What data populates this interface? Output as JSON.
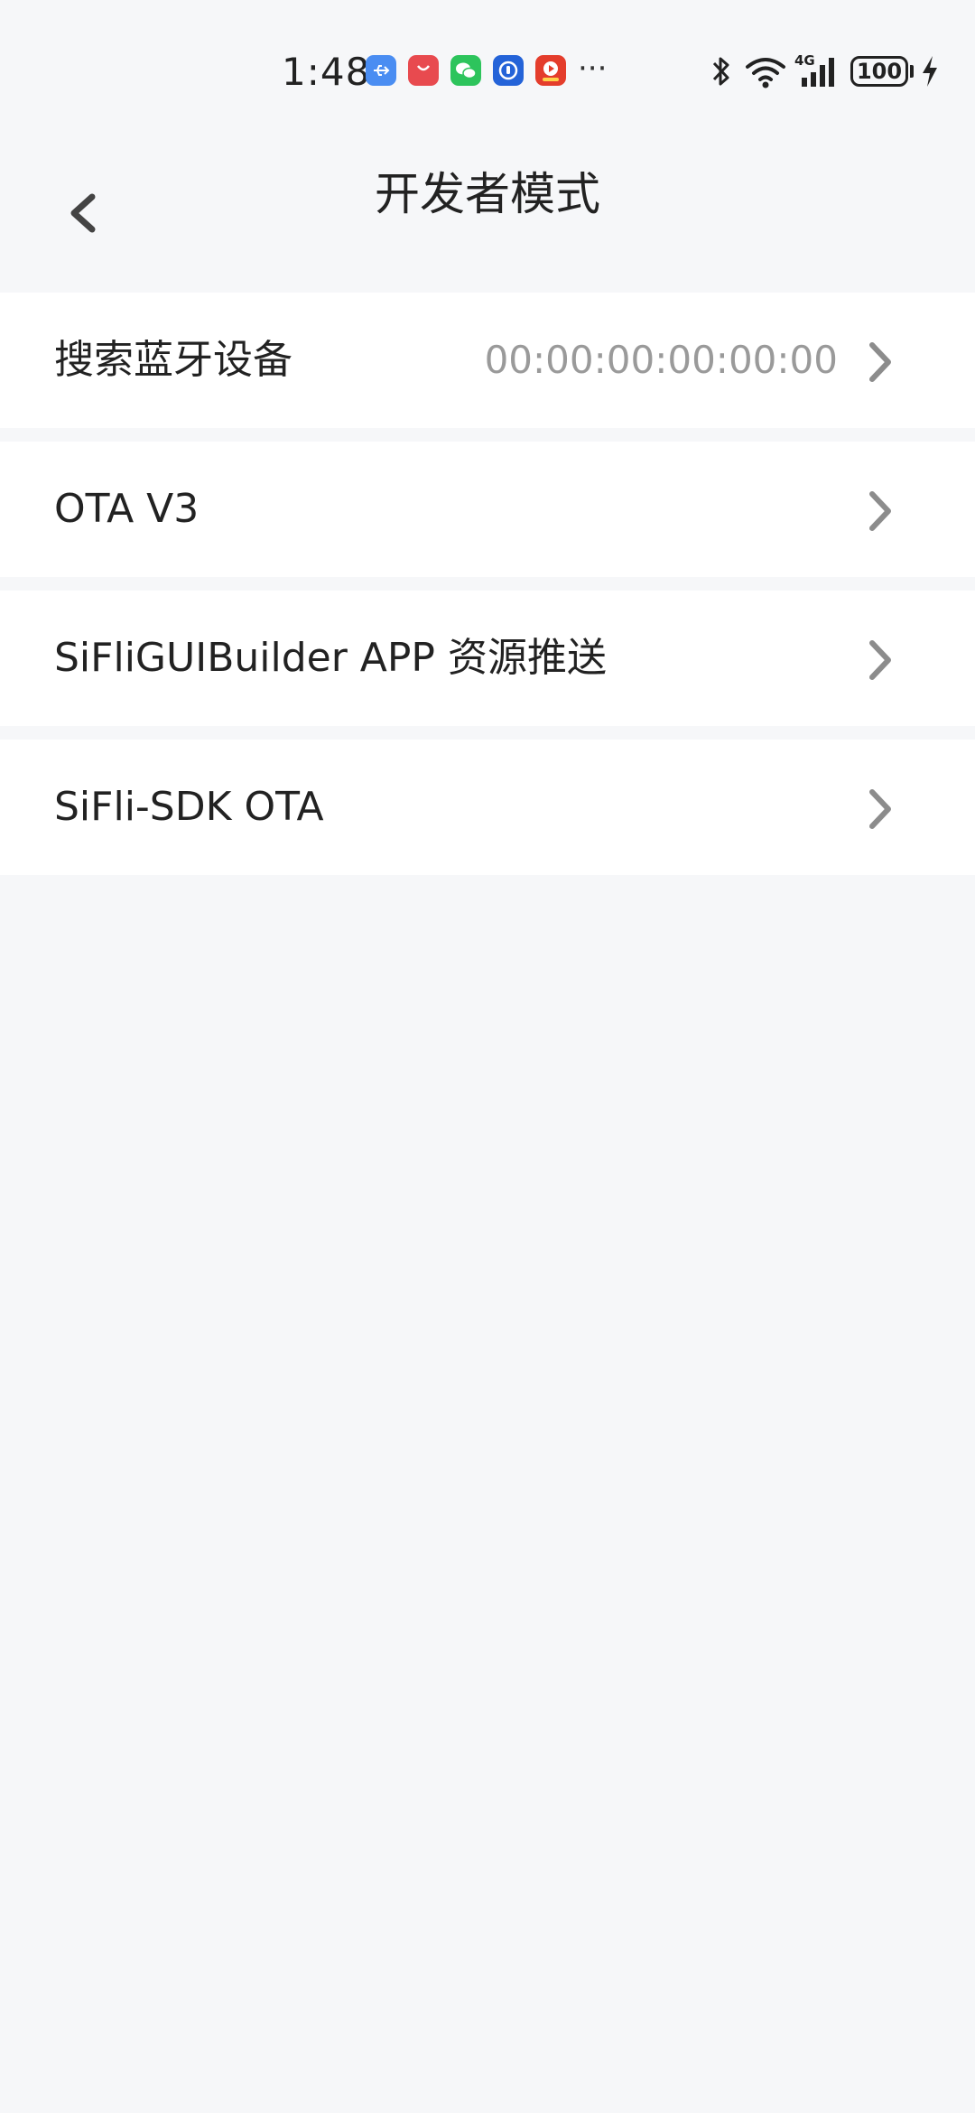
{
  "status_bar": {
    "time": "1:48",
    "notification_icons": [
      "usb-icon",
      "huawei-appgallery-icon",
      "wechat-icon",
      "blue-app-icon",
      "video-app-icon"
    ],
    "more": "···",
    "battery": "100",
    "right_icons": [
      "bluetooth-icon",
      "wifi-icon",
      "4g-signal-icon",
      "battery-icon",
      "charging-icon"
    ]
  },
  "header": {
    "title": "开发者模式",
    "back_icon": "chevron-left-icon"
  },
  "menu": {
    "items": [
      {
        "label": "搜索蓝牙设备",
        "value": "00:00:00:00:00:00"
      },
      {
        "label": "OTA V3",
        "value": ""
      },
      {
        "label": "SiFliGUIBuilder APP 资源推送",
        "value": ""
      },
      {
        "label": "SiFli-SDK OTA",
        "value": ""
      }
    ]
  },
  "colors": {
    "background": "#f6f7f9",
    "row_background": "#ffffff",
    "primary_text": "#222222",
    "secondary_text": "#9a9a9a",
    "chevron": "#8c8c8c"
  }
}
